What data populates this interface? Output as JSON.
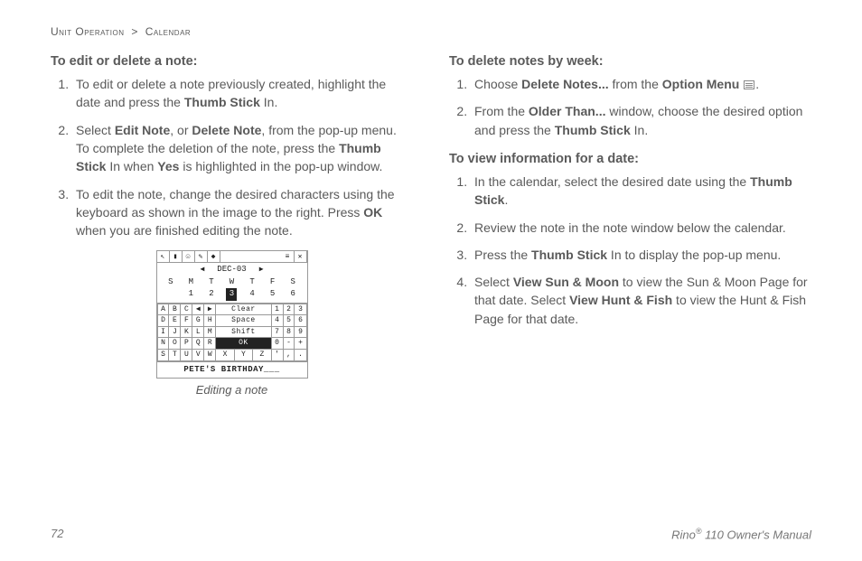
{
  "breadcrumb": {
    "section": "Unit Operation",
    "sep": ">",
    "page": "Calendar"
  },
  "left": {
    "h1": "To edit or delete a note:",
    "li1_a": "To edit or delete a note previously created, highlight the date and press the ",
    "li1_b": "Thumb Stick",
    "li1_c": " In.",
    "li2_a": "Select ",
    "li2_b": "Edit Note",
    "li2_c": ", or ",
    "li2_d": "Delete Note",
    "li2_e": ", from the pop-up menu. To complete the deletion of the note, press the ",
    "li2_f": "Thumb Stick",
    "li2_g": " In when ",
    "li2_h": "Yes",
    "li2_i": " is highlighted in the pop-up window.",
    "li3_a": "To edit the note, change the desired characters using the keyboard as shown in the image to the right. Press ",
    "li3_b": "OK",
    "li3_c": " when you are finished editing the note.",
    "fig": {
      "date": "DEC-03",
      "week": [
        "S",
        "M",
        "T",
        "W",
        "T",
        "F",
        "S"
      ],
      "nums": [
        "",
        "1",
        "2",
        "3",
        "4",
        "5",
        "6"
      ],
      "highlight_index": 3,
      "rows": [
        [
          "A",
          "B",
          "C",
          "◀",
          "▶",
          "Clear",
          "1",
          "2",
          "3"
        ],
        [
          "D",
          "E",
          "F",
          "G",
          "H",
          "Space",
          "4",
          "5",
          "6"
        ],
        [
          "I",
          "J",
          "K",
          "L",
          "M",
          "Shift",
          "7",
          "8",
          "9"
        ],
        [
          "N",
          "O",
          "P",
          "Q",
          "R",
          "OK",
          "0",
          "-",
          "+"
        ],
        [
          "S",
          "T",
          "U",
          "V",
          "W",
          "X",
          "Y",
          "Z",
          "'",
          ",",
          "."
        ]
      ],
      "note_line": "PETE'S BIRTHDAY___",
      "caption": "Editing a note"
    }
  },
  "right": {
    "h1": "To delete notes by week:",
    "r1_li1_a": "Choose ",
    "r1_li1_b": "Delete Notes...",
    "r1_li1_c": " from the ",
    "r1_li1_d": "Option Menu",
    "r1_li1_e": ".",
    "r1_li2_a": "From the ",
    "r1_li2_b": "Older Than...",
    "r1_li2_c": " window, choose the desired option and press the ",
    "r1_li2_d": "Thumb Stick",
    "r1_li2_e": " In.",
    "h2": "To view information for a date:",
    "r2_li1_a": "In the calendar, select the desired date using the ",
    "r2_li1_b": "Thumb Stick",
    "r2_li1_c": ".",
    "r2_li2": "Review the note in the note window below the calendar.",
    "r2_li3_a": "Press the ",
    "r2_li3_b": "Thumb Stick",
    "r2_li3_c": " In to display the pop-up menu.",
    "r2_li4_a": "Select ",
    "r2_li4_b": "View Sun & Moon",
    "r2_li4_c": " to view the Sun & Moon Page for that date. Select ",
    "r2_li4_d": "View Hunt & Fish",
    "r2_li4_e": " to view the Hunt & Fish Page for that date."
  },
  "footer": {
    "page_number": "72",
    "title_a": "Rino",
    "title_b": "®",
    "title_c": " 110 Owner's Manual"
  }
}
